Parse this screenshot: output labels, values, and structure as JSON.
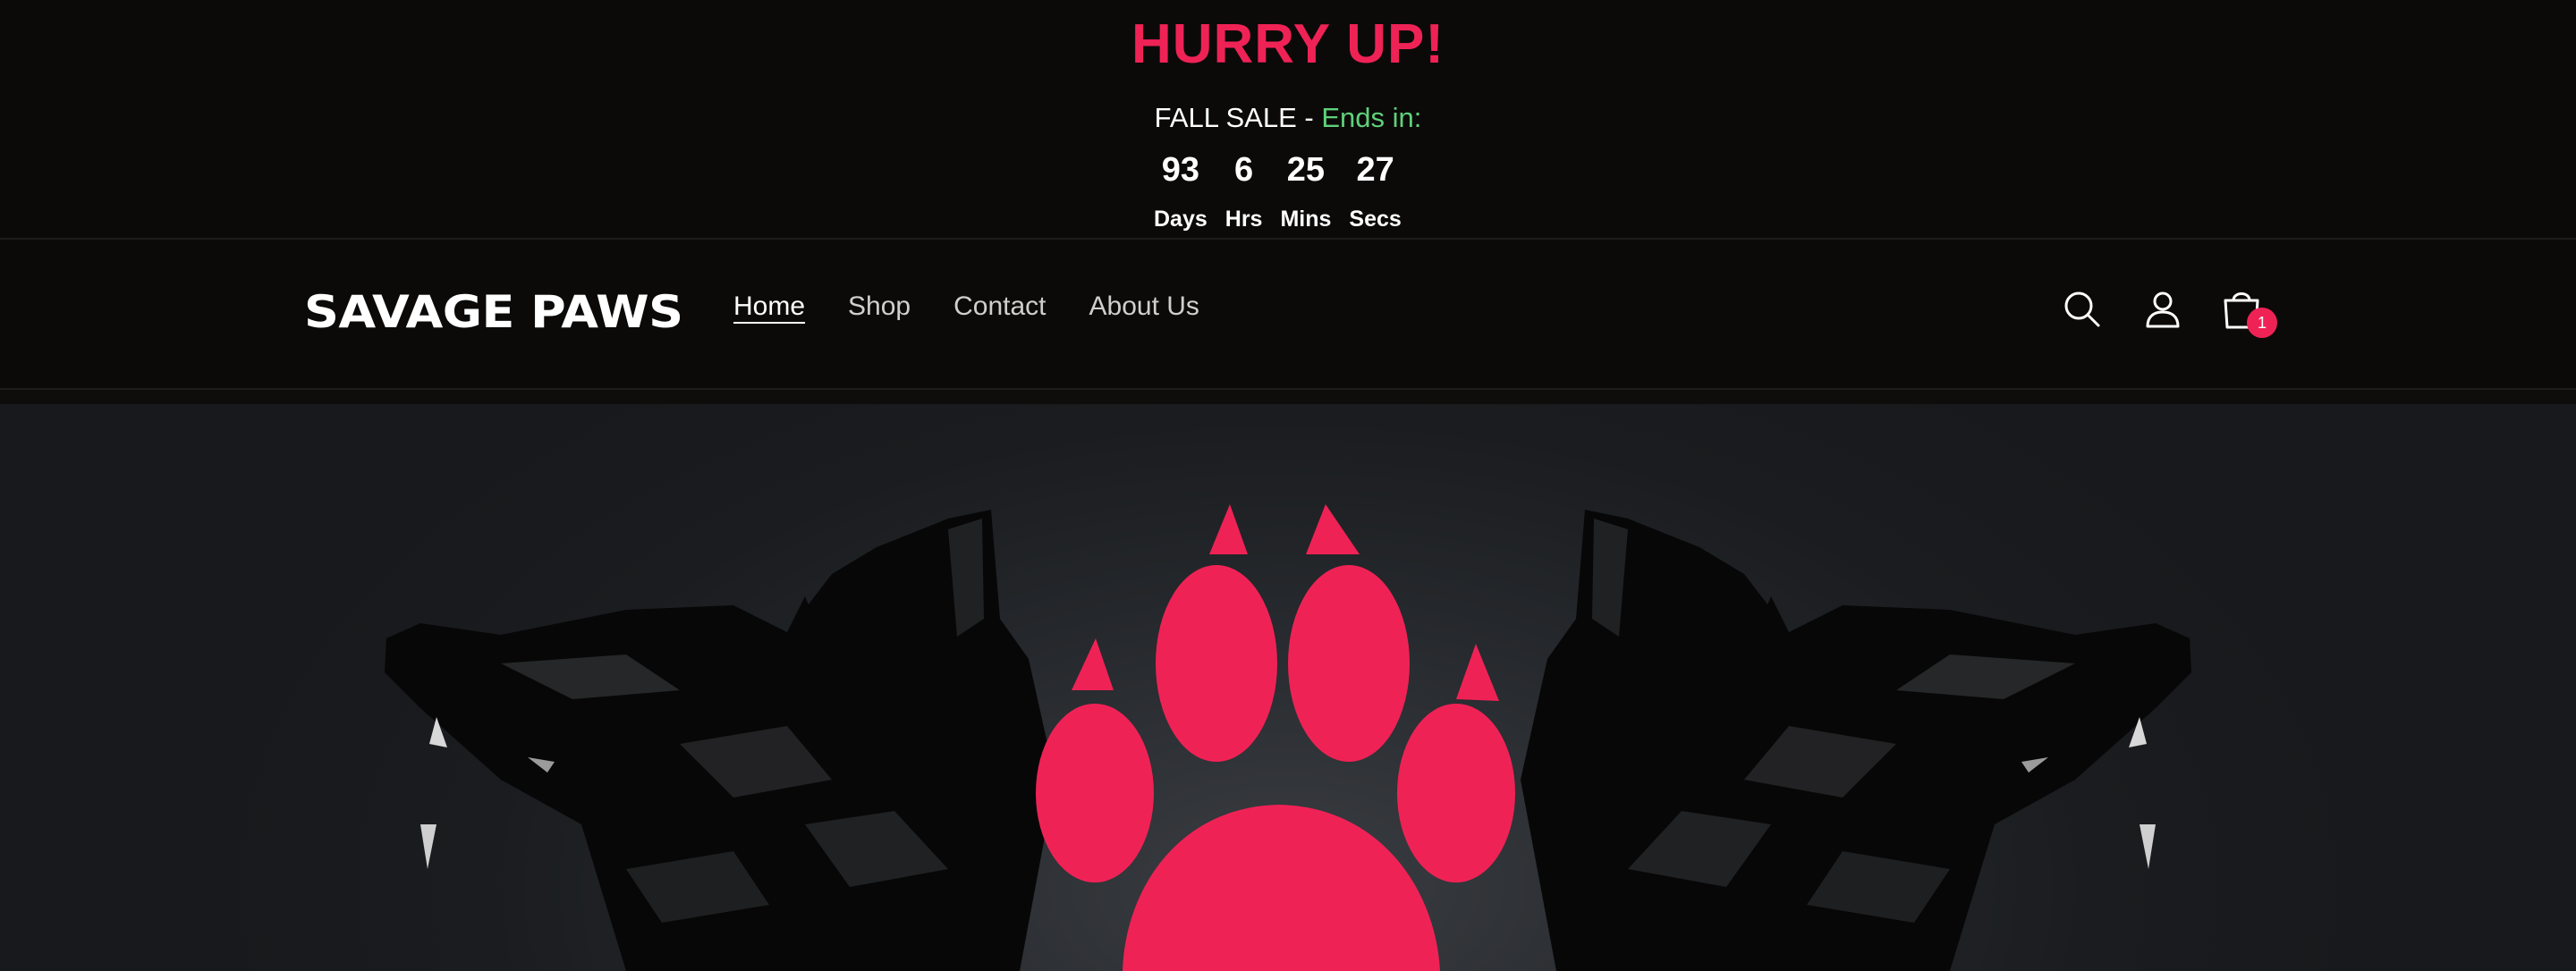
{
  "announcement": {
    "heading": "HURRY UP!",
    "sale_text": "FALL SALE",
    "separator": " - ",
    "ends_text": "Ends in:",
    "countdown": [
      {
        "value": "93",
        "label": "Days"
      },
      {
        "value": "6",
        "label": "Hrs"
      },
      {
        "value": "25",
        "label": "Mins"
      },
      {
        "value": "27",
        "label": "Secs"
      }
    ]
  },
  "header": {
    "logo": "SAVAGE PAWS",
    "nav": [
      {
        "label": "Home",
        "active": true
      },
      {
        "label": "Shop",
        "active": false
      },
      {
        "label": "Contact",
        "active": false
      },
      {
        "label": "About Us",
        "active": false
      }
    ],
    "icons": [
      "search-icon",
      "account-icon",
      "cart-icon"
    ],
    "cart_count": "1"
  },
  "hero": {
    "image": "two black dogs flanking a pink paw print logo"
  },
  "colors": {
    "accent": "#ef2256",
    "ends_green": "#5fd17a",
    "background": "#0b0a09",
    "hero_bg": "#1a1c1f"
  }
}
